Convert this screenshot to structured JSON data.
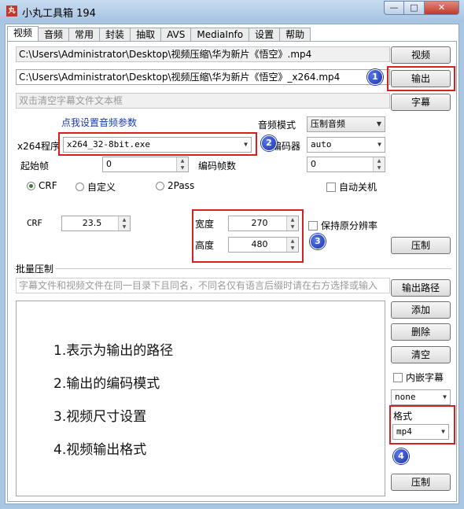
{
  "window": {
    "title": "小丸工具箱 194",
    "icon": "丸"
  },
  "tabs": [
    {
      "label": "视频",
      "active": true
    },
    {
      "label": "音频"
    },
    {
      "label": "常用"
    },
    {
      "label": "封装"
    },
    {
      "label": "抽取"
    },
    {
      "label": "AVS"
    },
    {
      "label": "MediaInfo"
    },
    {
      "label": "设置"
    },
    {
      "label": "帮助"
    }
  ],
  "files": {
    "input_path": "C:\\Users\\Administrator\\Desktop\\视频压缩\\华为新片《悟空》.mp4",
    "output_path": "C:\\Users\\Administrator\\Desktop\\视频压缩\\华为新片《悟空》_x264.mp4",
    "subtitle_placeholder": "双击清空字幕文件文本框",
    "video_button": "视频",
    "output_button": "输出",
    "subtitle_button": "字幕"
  },
  "audio": {
    "link": "点我设置音频参数",
    "mode_label": "音频模式",
    "mode_value": "压制音频",
    "encoder_label": "编码器",
    "encoder_value": "auto"
  },
  "x264": {
    "program_label": "x264程序",
    "program_value": "x264_32-8bit.exe",
    "start_frame_label": "起始帧",
    "start_frame_value": "0",
    "frame_count_label": "编码帧数",
    "frame_count_value": "0"
  },
  "mode": {
    "crf": "CRF",
    "custom": "自定义",
    "twopass": "2Pass",
    "auto_shutdown": "自动关机",
    "crf_label": "CRF",
    "crf_value": "23.5"
  },
  "size": {
    "width_label": "宽度",
    "width_value": "270",
    "height_label": "高度",
    "height_value": "480",
    "keep_resolution": "保持原分辨率"
  },
  "compress_button": "压制",
  "batch": {
    "group_label": "批量压制",
    "hint": "字幕文件和视频文件在同一目录下且同名，不同名仅有语言后缀时请在右方选择或输入",
    "output_path_button": "输出路径",
    "add_button": "添加",
    "delete_button": "删除",
    "clear_button": "清空",
    "embed_subtitle": "内嵌字幕",
    "subtitle_lang": "none",
    "format_label": "格式",
    "format_value": "mp4",
    "compress_button": "压制"
  },
  "notes": [
    "1.表示为输出的路径",
    "2.输出的编码模式",
    "3.视频尺寸设置",
    "4.视频输出格式"
  ],
  "badges": [
    "1",
    "2",
    "3",
    "4"
  ],
  "colors": {
    "annotation_red": "#d42020",
    "badge_blue": "#1a30b0",
    "link_blue": "#1a3ab0"
  }
}
